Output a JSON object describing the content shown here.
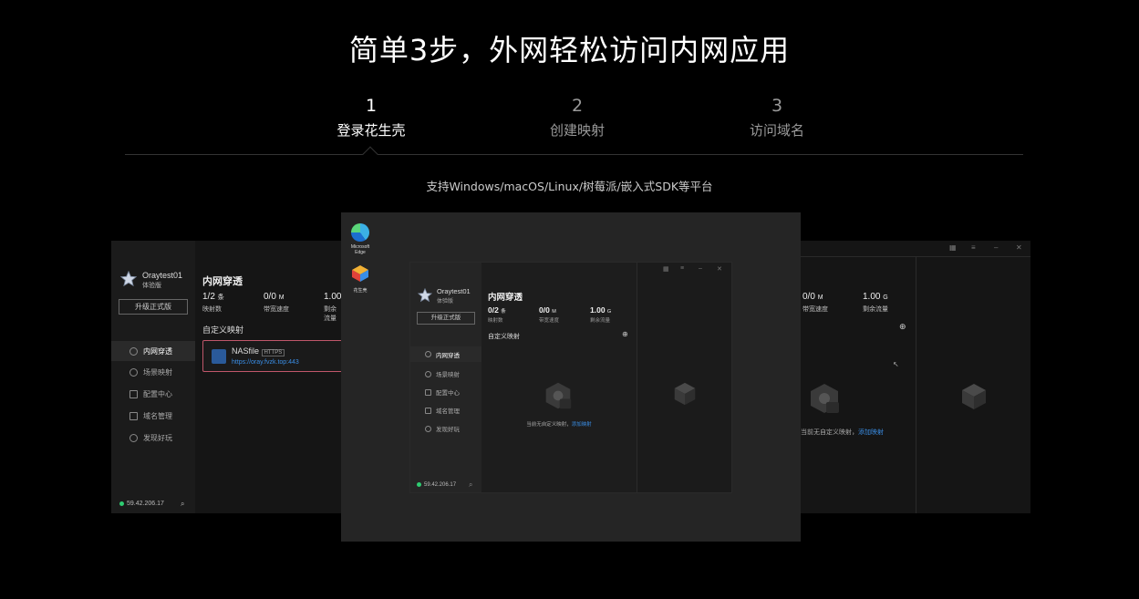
{
  "headline": "简单3步，外网轻松访问内网应用",
  "steps": [
    {
      "num": "1",
      "label": "登录花生壳",
      "active": true
    },
    {
      "num": "2",
      "label": "创建映射",
      "active": false
    },
    {
      "num": "3",
      "label": "访问域名",
      "active": false
    }
  ],
  "platforms": "支持Windows/macOS/Linux/树莓派/嵌入式SDK等平台",
  "desktop_icons": [
    {
      "label": "Microsoft Edge",
      "icon": "edge-icon"
    },
    {
      "label": "花生壳",
      "icon": "peanut-shell-icon"
    }
  ],
  "app": {
    "username": "Oraytest01",
    "edition": "体验版",
    "upgrade_button": "升级正式版",
    "section_title": "内网穿透",
    "stats": [
      {
        "value": "0/2",
        "unit": "条",
        "label": "映射数"
      },
      {
        "value": "0/0",
        "unit": "M",
        "label": "带宽速度"
      },
      {
        "value": "1.00",
        "unit": "G",
        "label": "剩余流量"
      }
    ],
    "custom_mapping_title": "自定义映射",
    "empty_text": "当前无自定义映射，",
    "empty_link": "添加映射",
    "nav": [
      {
        "label": "内网穿透",
        "selected": true
      },
      {
        "label": "场景映射",
        "selected": false
      },
      {
        "label": "配置中心",
        "selected": false
      },
      {
        "label": "域名管理",
        "selected": false
      },
      {
        "label": "发现好玩",
        "selected": false
      }
    ],
    "ip": "59.42.206.17"
  },
  "left_window": {
    "username": "Oraytest01",
    "edition": "体验版",
    "upgrade_button": "升级正式版",
    "section_title": "内网穿透",
    "stats": [
      {
        "value": "1/2",
        "unit": "条",
        "label": "映射数"
      },
      {
        "value": "0/0",
        "unit": "M",
        "label": "带宽速度"
      },
      {
        "value": "1.00",
        "unit": "",
        "label": "剩余流量"
      }
    ],
    "custom_mapping_title": "自定义映射",
    "mapping_name": "NASfile",
    "mapping_tag": "HTTPS",
    "mapping_url": "https://oray.fvzk.top:443",
    "nav": [
      "内网穿透",
      "场景映射",
      "配置中心",
      "域名管理",
      "发现好玩"
    ],
    "ip": "59.42.206.17"
  },
  "right_window": {
    "stats": [
      {
        "value": "0/0",
        "unit": "M",
        "label": "带宽速度"
      },
      {
        "value": "1.00",
        "unit": "G",
        "label": "剩余流量"
      }
    ],
    "empty_text": "当前无自定义映射，",
    "empty_link": "添加映射"
  },
  "colors": {
    "accent_link": "#3a8ee6",
    "online": "#2ecc71",
    "highlight_border": "#c0566a"
  }
}
